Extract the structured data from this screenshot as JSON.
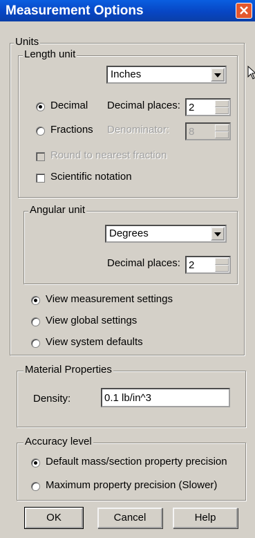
{
  "dialog": {
    "title": "Measurement Options"
  },
  "units": {
    "group_label": "Units",
    "length": {
      "group_label": "Length unit",
      "unit_selected": "Inches",
      "decimal_label": "Decimal",
      "decimal_places_label": "Decimal places:",
      "decimal_places_value": "2",
      "fractions_label": "Fractions",
      "denominator_label": "Denominator:",
      "denominator_value": "8",
      "round_label": "Round to nearest fraction",
      "scientific_label": "Scientific notation"
    },
    "angular": {
      "group_label": "Angular unit",
      "unit_selected": "Degrees",
      "decimal_places_label": "Decimal places:",
      "decimal_places_value": "2"
    },
    "view_measurement": "View measurement settings",
    "view_global": "View global settings",
    "view_system": "View system defaults"
  },
  "material": {
    "group_label": "Material Properties",
    "density_label": "Density:",
    "density_value": "0.1 lb/in^3"
  },
  "accuracy": {
    "group_label": "Accuracy level",
    "default_label": "Default mass/section property precision",
    "maximum_label": "Maximum property precision (Slower)"
  },
  "buttons": {
    "ok": "OK",
    "cancel": "Cancel",
    "help": "Help"
  }
}
